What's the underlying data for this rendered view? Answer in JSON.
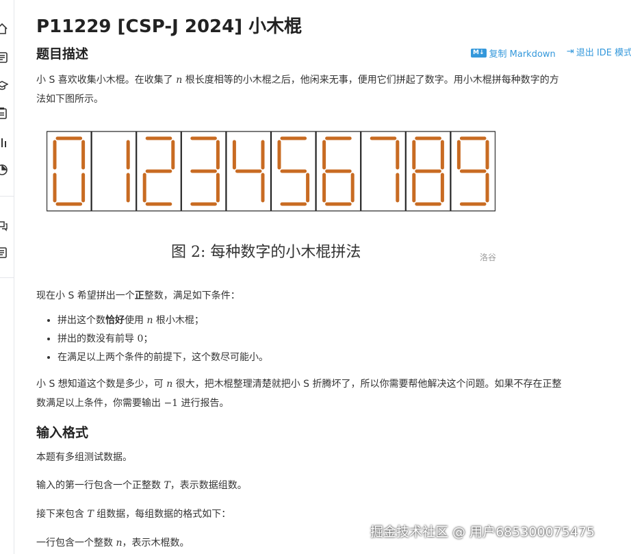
{
  "problem": {
    "title": "P11229 [CSP-J 2024] 小木棍",
    "section_description": "题目描述",
    "toolbar": {
      "copy_badge": "M↓",
      "copy_markdown": "复制 Markdown",
      "exit_ide_icon": "exit-icon",
      "exit_ide": "退出 IDE 模式"
    },
    "intro": {
      "p1_pre": "小 S 喜欢收集小木棍。在收集了 ",
      "p1_var": "n",
      "p1_post": " 根长度相等的小木棍之后，他闲来无事，便用它们拼起了数字。用小木棍拼每种数字的方",
      "p1_cont": "法如下图所示。"
    },
    "figure": {
      "digits": [
        "0",
        "1",
        "2",
        "3",
        "4",
        "5",
        "6",
        "7",
        "8",
        "9"
      ],
      "segment_color": "#c86b22",
      "caption": "图 2: 每种数字的小木棍拼法",
      "watermark": "洛谷"
    },
    "conditions": {
      "lead_pre": "现在小 S 希望拼出一个",
      "lead_bold": "正",
      "lead_post": "整数，满足如下条件：",
      "items": [
        {
          "pre": "拼出这个数",
          "bold": "恰好",
          "mid": "使用 ",
          "var": "n",
          "post": " 根小木棍；"
        },
        {
          "pre": "拼出的数没有前导 ",
          "num": "0",
          "post": "；"
        },
        {
          "text": "在满足以上两个条件的前提下，这个数尽可能小。"
        }
      ]
    },
    "para2": {
      "pre": "小 S 想知道这个数是多少，可 ",
      "var": "n",
      "post": " 很大，把木棍整理清楚就把小 S 折腾坏了，所以你需要帮他解决这个问题。如果不存在正整",
      "cont_pre": "数满足以上条件，你需要输出 ",
      "cont_num": "−1",
      "cont_post": " 进行报告。"
    },
    "input_format": {
      "heading": "输入格式",
      "l1": "本题有多组测试数据。",
      "l2_pre": "输入的第一行包含一个正整数 ",
      "l2_var": "T",
      "l2_post": "，表示数据组数。",
      "l3_pre": "接下来包含 ",
      "l3_var": "T",
      "l3_post": " 组数据，每组数据的格式如下：",
      "l4_pre": "一行包含一个整数 ",
      "l4_var": "n",
      "l4_post": "，表示木棍数。"
    },
    "page_watermark": "掘金技术社区 @ 用户685300075475"
  },
  "sidebar": {
    "icons": [
      "home-icon",
      "list-icon",
      "graduation-cap-icon",
      "clipboard-icon",
      "bar-chart-icon",
      "pie-chart-icon",
      "chat-icon",
      "document-icon"
    ]
  }
}
